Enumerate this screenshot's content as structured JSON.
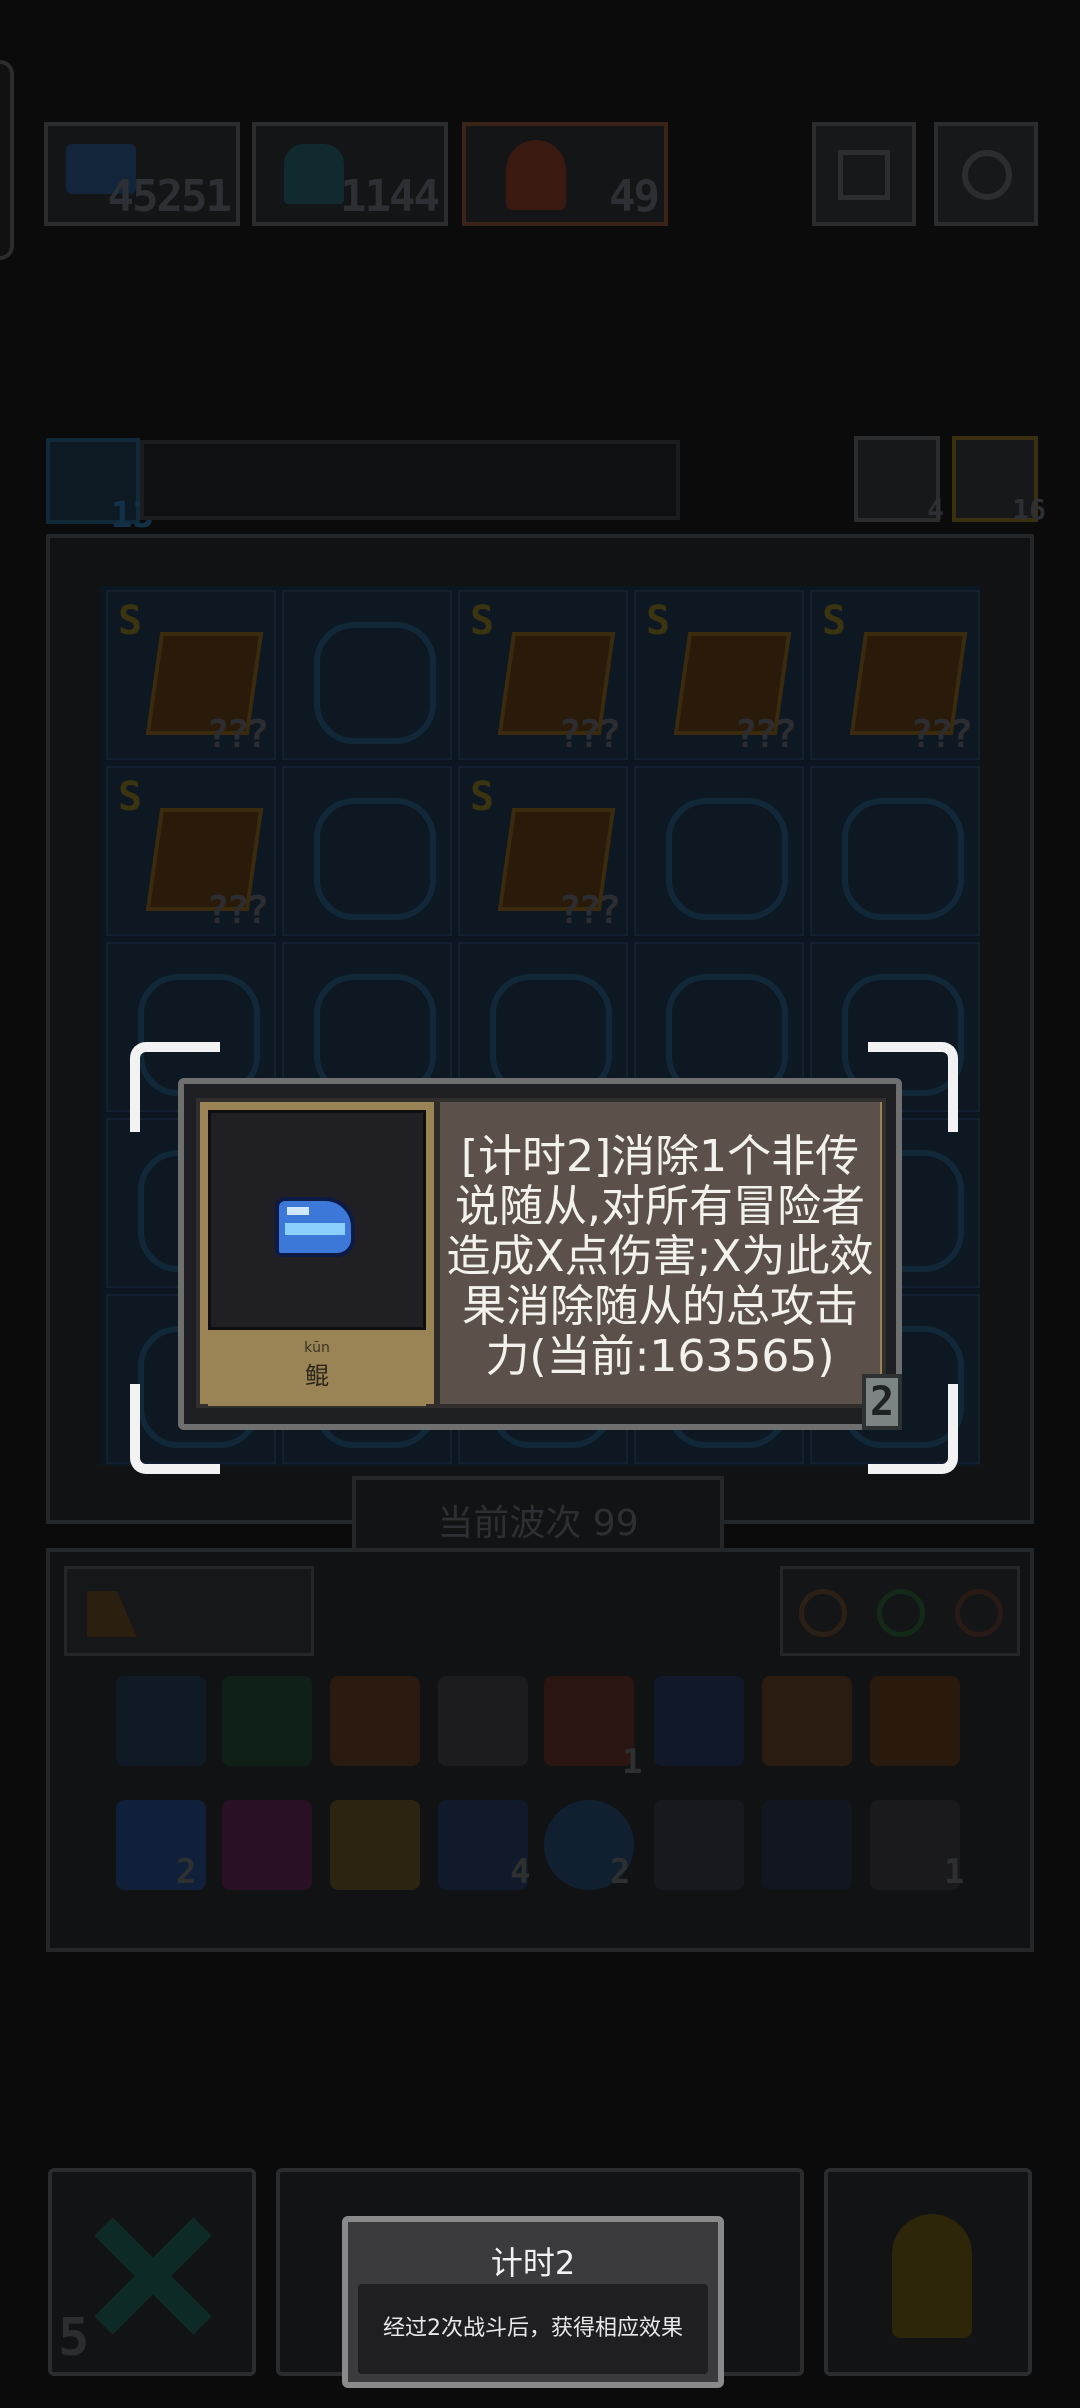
{
  "currency": {
    "gems": "45251",
    "secondary": "1144",
    "tertiary": "49"
  },
  "board": {
    "level_badge": "13",
    "stat_a": "4",
    "stat_b": "16",
    "slots": [
      {
        "type": "S",
        "label": "???"
      },
      {
        "type": "empty"
      },
      {
        "type": "S",
        "label": "???"
      },
      {
        "type": "S",
        "label": "???"
      },
      {
        "type": "S",
        "label": "???"
      },
      {
        "type": "S",
        "label": "???"
      },
      {
        "type": "empty"
      },
      {
        "type": "S",
        "label": "???"
      },
      {
        "type": "empty"
      },
      {
        "type": "empty"
      }
    ],
    "wave_label": "当前波次 99"
  },
  "inventory": {
    "counts": [
      "1",
      "2",
      "4",
      "2",
      "1"
    ]
  },
  "popup": {
    "item_pinyin": "kūn",
    "item_name": "鲲",
    "description_lines": [
      "[计时2]消除1个非传",
      "说随从,对所有冒险者",
      "造成X点伤害;X为此效",
      "果消除随从的总攻击",
      "力(当前:163565)"
    ],
    "level_badge": "2"
  },
  "bottom": {
    "left_count": "5"
  },
  "toast": {
    "title": "计时2",
    "body": "经过2次战斗后，获得相应效果"
  },
  "colors": {
    "accent_gold": "#9a8456",
    "card_bg": "#1e1f22",
    "text_light": "#f3f1ec"
  }
}
